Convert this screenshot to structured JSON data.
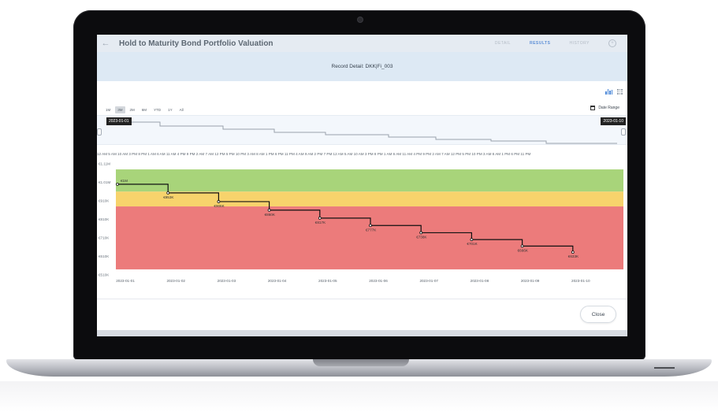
{
  "app": {
    "title": "Hold to Maturity Bond Portfolio Valuation",
    "back_icon": "arrow-left-icon",
    "tabs": [
      {
        "label": "DETAIL",
        "active": false
      },
      {
        "label": "RESULTS",
        "active": true
      },
      {
        "label": "HISTORY",
        "active": false
      }
    ],
    "action_icon": "circle-plus-icon"
  },
  "record": {
    "title": "Record Detail: DKK|Fi_003"
  },
  "view_toggle": {
    "chart_icon": "bar-chart-icon",
    "table_icon": "grid-table-icon"
  },
  "range_buttons": [
    "1M",
    "3M",
    "2M",
    "6M",
    "YTD",
    "1Y",
    "All"
  ],
  "range_selected": "3M",
  "date_range": {
    "label": "Date Range",
    "icon": "calendar-icon"
  },
  "navigator": {
    "start_label": "2023-01-01",
    "end_label": "2023-01-10"
  },
  "time_axis_text": "12 AM 5 AM 10 AM 3 PM 8 PM 1 AM 6 AM 11 AM 4 PM 9 PM 2 AM 7 AM 12 PM 5 PM 10 PM 3 AM 8 AM 1 PM 6 PM 11 PM 4 AM 9 AM 2 PM 7 PM 12 AM 5 AM 10 AM 3 PM 8 PM 1 AM 6 AM 11 AM 4 PM 9 PM 2 AM 7 AM 12 PM 5 PM 10 PM 3 AM 8 AM 1 PM 6 PM 11 PM",
  "colors": {
    "band_green": "#a8d47a",
    "band_yellow": "#f7d36c",
    "band_red": "#ec7b7b",
    "line": "#111111",
    "accent": "#5d8fd6"
  },
  "chart_data": {
    "type": "line",
    "step": true,
    "x": [
      "2023-01-01",
      "2023-01-02",
      "2023-01-03",
      "2023-01-04",
      "2023-01-05",
      "2023-01-06",
      "2023-01-07",
      "2023-01-08",
      "2023-01-09",
      "2023-01-10"
    ],
    "values": [
      1000,
      953,
      906,
      860,
      817,
      777,
      738,
      701,
      666,
      633
    ],
    "point_labels": [
      "€1M",
      "€953K",
      "€906K",
      "€860K",
      "€817K",
      "€777K",
      "€738K",
      "€701K",
      "€666K",
      "€633K"
    ],
    "y_ticks": [
      {
        "value": 1110,
        "label": "€1.11M"
      },
      {
        "value": 1010,
        "label": "€1.01M"
      },
      {
        "value": 910,
        "label": "€910K"
      },
      {
        "value": 810,
        "label": "€810K"
      },
      {
        "value": 710,
        "label": "€710K"
      },
      {
        "value": 610,
        "label": "€610K"
      },
      {
        "value": 510,
        "label": "€510K"
      }
    ],
    "ylim": [
      510,
      1110
    ],
    "bands": [
      {
        "from": 960,
        "to": 1080,
        "color": "green"
      },
      {
        "from": 880,
        "to": 960,
        "color": "yellow"
      },
      {
        "from": 540,
        "to": 880,
        "color": "red"
      }
    ],
    "title": "",
    "xlabel": "",
    "ylabel": ""
  },
  "footer": {
    "close_label": "Close"
  }
}
